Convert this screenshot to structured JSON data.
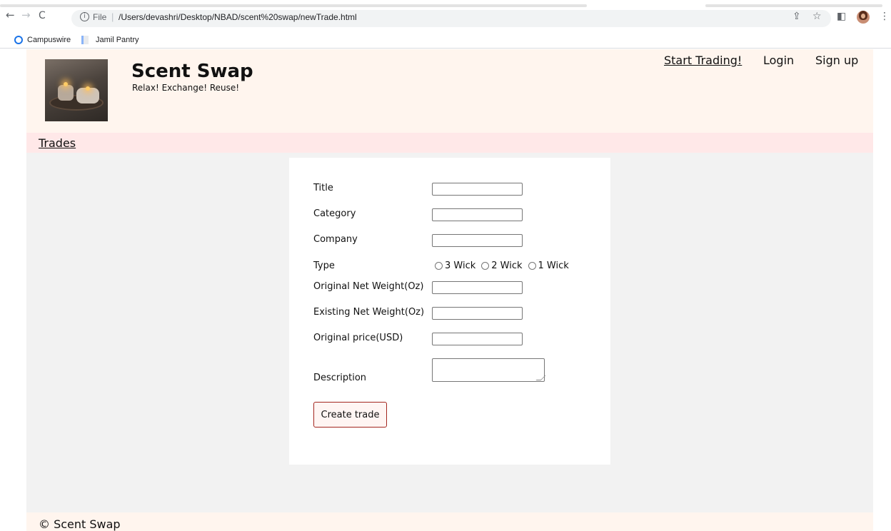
{
  "browser": {
    "back_icon": "←",
    "forward_icon": "→",
    "reload_icon": "C",
    "scheme_label": "File",
    "url": "/Users/devashri/Desktop/NBAD/scent%20swap/newTrade.html",
    "bookmarks": [
      "Campuswire",
      "Jamil Pantry"
    ],
    "share_icon": "⇪",
    "star_icon": "☆",
    "sidepanel_icon": "◧",
    "menu_icon": "⋮"
  },
  "header": {
    "title": "Scent Swap",
    "tagline": "Relax! Exchange! Reuse!",
    "links": [
      "Start Trading!",
      "Login",
      "Sign up"
    ]
  },
  "subnav": {
    "trades_label": "Trades"
  },
  "form": {
    "title_label": "Title",
    "category_label": "Category",
    "company_label": "Company",
    "type_label": "Type",
    "type_options": [
      "3 Wick",
      "2 Wick",
      "1 Wick"
    ],
    "orig_weight_label": "Original Net Weight(Oz)",
    "exist_weight_label": "Existing Net Weight(Oz)",
    "orig_price_label": "Original price(USD)",
    "description_label": "Description",
    "submit_label": "Create trade"
  },
  "footer": {
    "text": "© Scent Swap"
  },
  "colors": {
    "header_bg": "#fff5ee",
    "subnav_bg": "#ffe8e8",
    "page_bg": "#f2f2f2",
    "button_border": "#a3261f"
  }
}
